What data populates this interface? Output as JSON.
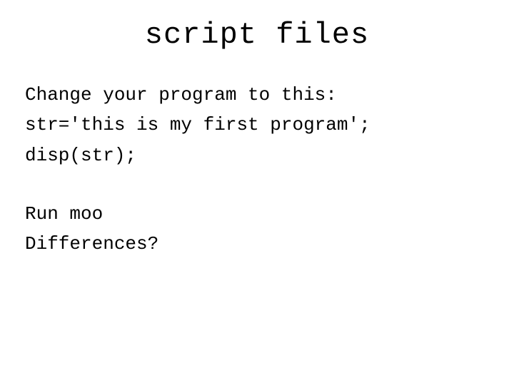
{
  "title": "script files",
  "lines": {
    "l1": "Change your program to this:",
    "l2": "str='this is my first program';",
    "l3": "disp(str);",
    "l4": "Run moo",
    "l5": "Differences?"
  }
}
